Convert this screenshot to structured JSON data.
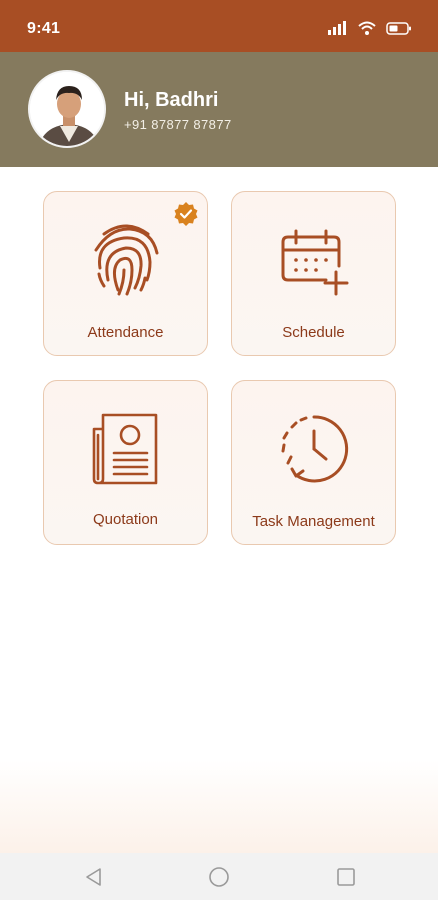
{
  "status_bar": {
    "time": "9:41",
    "icons": [
      "signal-icon",
      "wifi-icon",
      "battery-icon"
    ]
  },
  "header": {
    "greeting": "Hi, Badhri",
    "phone": "+91 87877 87877"
  },
  "menu": {
    "attendance": "Attendance",
    "schedule": "Schedule",
    "quotation": "Quotation",
    "task_management": "Task Management"
  },
  "colors": {
    "status_bar": "#a84e24",
    "header": "#857a5e",
    "accent": "#a84e24",
    "badge": "#d9821f",
    "card_border": "#e9c9b0"
  },
  "nav": [
    "back-icon",
    "home-icon",
    "recents-icon"
  ]
}
